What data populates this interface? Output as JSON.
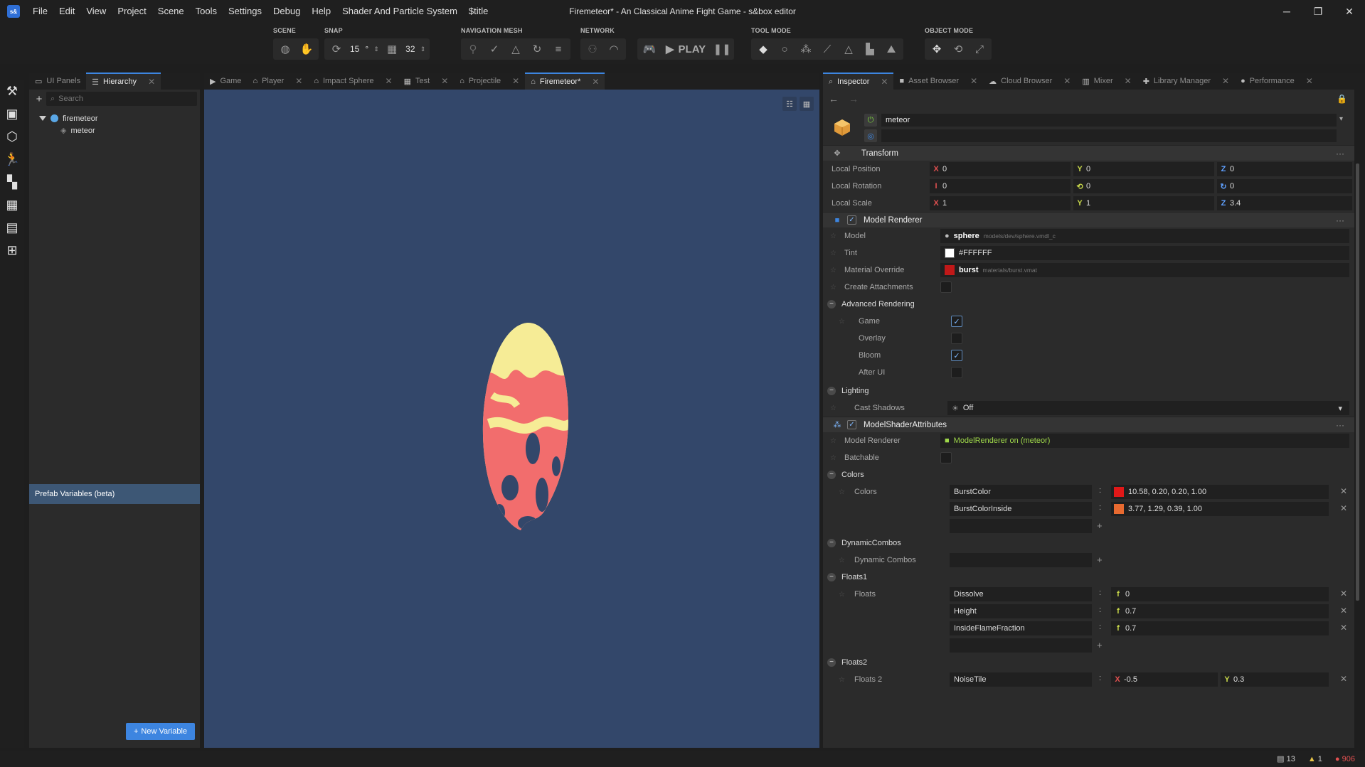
{
  "window": {
    "title": "Firemeteor* - An Classical Anime Fight Game - s&box editor",
    "logo": "s&"
  },
  "menu": [
    "File",
    "Edit",
    "View",
    "Project",
    "Scene",
    "Tools",
    "Settings",
    "Debug",
    "Help",
    "Shader And Particle System",
    "$title"
  ],
  "toolbar": {
    "scene_label": "SCENE",
    "snap_label": "SNAP",
    "snap_angle": "15",
    "snap_angle_unit": "°",
    "snap_grid": "32",
    "navmesh_label": "NAVIGATION MESH",
    "network_label": "NETWORK",
    "play_label": "PLAY",
    "toolmode_label": "TOOL MODE",
    "objectmode_label": "OBJECT MODE"
  },
  "left_tabs": [
    {
      "label": "UI Panels",
      "active": false
    },
    {
      "label": "Hierarchy",
      "active": true
    }
  ],
  "hierarchy": {
    "search_placeholder": "Search",
    "root": "firemeteor",
    "child": "meteor",
    "prefab_label": "Prefab Variables (beta)",
    "new_variable": "New Variable"
  },
  "center_tabs": [
    {
      "label": "Game"
    },
    {
      "label": "Player"
    },
    {
      "label": "Impact Sphere"
    },
    {
      "label": "Test"
    },
    {
      "label": "Projectile"
    },
    {
      "label": "Firemeteor*"
    }
  ],
  "right_tabs": [
    {
      "label": "Inspector"
    },
    {
      "label": "Asset Browser"
    },
    {
      "label": "Cloud Browser"
    },
    {
      "label": "Mixer"
    },
    {
      "label": "Library Manager"
    },
    {
      "label": "Performance"
    }
  ],
  "inspector": {
    "object_name": "meteor",
    "transform": {
      "title": "Transform",
      "position_label": "Local Position",
      "pos": [
        "0",
        "0",
        "0"
      ],
      "rotation_label": "Local Rotation",
      "rot": [
        "0",
        "0",
        "0"
      ],
      "scale_label": "Local Scale",
      "scale": [
        "1",
        "1",
        "3.4"
      ]
    },
    "model_renderer": {
      "title": "Model Renderer",
      "model_label": "Model",
      "model_name": "sphere",
      "model_path": "models/dev/sphere.vmdl_c",
      "tint_label": "Tint",
      "tint_value": "#FFFFFF",
      "material_label": "Material Override",
      "material_name": "burst",
      "material_path": "materials/burst.vmat",
      "attach_label": "Create Attachments",
      "adv_label": "Advanced Rendering",
      "game_label": "Game",
      "overlay_label": "Overlay",
      "bloom_label": "Bloom",
      "afterui_label": "After UI",
      "lighting_label": "Lighting",
      "shadows_label": "Cast Shadows",
      "shadows_value": "Off"
    },
    "shader_attrs": {
      "title": "ModelShaderAttributes",
      "mr_label": "Model Renderer",
      "mr_value": "ModelRenderer on (meteor)",
      "batch_label": "Batchable",
      "colors_group": "Colors",
      "colors_label": "Colors",
      "colors": [
        {
          "key": "BurstColor",
          "value": "10.58, 0.20, 0.20, 1.00",
          "swatch": "#e01818"
        },
        {
          "key": "BurstColorInside",
          "value": "3.77, 1.29, 0.39, 1.00",
          "swatch": "#e86a30"
        }
      ],
      "combos_group": "DynamicCombos",
      "combos_label": "Dynamic Combos",
      "floats_group": "Floats1",
      "floats_label": "Floats",
      "floats": [
        {
          "key": "Dissolve",
          "value": "0"
        },
        {
          "key": "Height",
          "value": "0.7"
        },
        {
          "key": "InsideFlameFraction",
          "value": "0.7"
        }
      ],
      "floats2_group": "Floats2",
      "floats2_label": "Floats 2",
      "noise_key": "NoiseTile",
      "noise_x": "-0.5",
      "noise_y": "0.3"
    }
  },
  "status": {
    "messages": "13",
    "warnings": "1",
    "errors": "906"
  },
  "colors": {
    "accent": "#3d85e0",
    "viewport_bg": "#33476a",
    "meteor_red": "#f26d6d",
    "meteor_yellow": "#f6ec96"
  }
}
